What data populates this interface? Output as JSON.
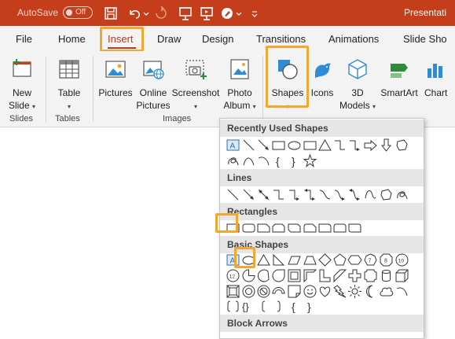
{
  "titlebar": {
    "autosave_label": "AutoSave",
    "autosave_state": "Off",
    "document_title": "Presentati"
  },
  "tabs": [
    "File",
    "Home",
    "Insert",
    "Draw",
    "Design",
    "Transitions",
    "Animations",
    "Slide Sho"
  ],
  "active_tab": "Insert",
  "ribbon": {
    "new_slide_line1": "New",
    "new_slide_line2": "Slide",
    "table": "Table",
    "pictures": "Pictures",
    "online_line1": "Online",
    "online_line2": "Pictures",
    "screenshot": "Screenshot",
    "album_line1": "Photo",
    "album_line2": "Album",
    "shapes": "Shapes",
    "icons": "Icons",
    "models_line1": "3D",
    "models_line2": "Models",
    "smartart": "SmartArt",
    "chart": "Chart",
    "groups": {
      "slides": "Slides",
      "tables": "Tables",
      "images": "Images"
    }
  },
  "shapes_menu": {
    "recent": "Recently Used Shapes",
    "lines": "Lines",
    "rectangles": "Rectangles",
    "basic": "Basic Shapes",
    "block_arrows": "Block Arrows"
  },
  "colors": {
    "accent": "#c43e1c",
    "highlight": "#f0a830",
    "tab_active": "#b83b1a"
  }
}
